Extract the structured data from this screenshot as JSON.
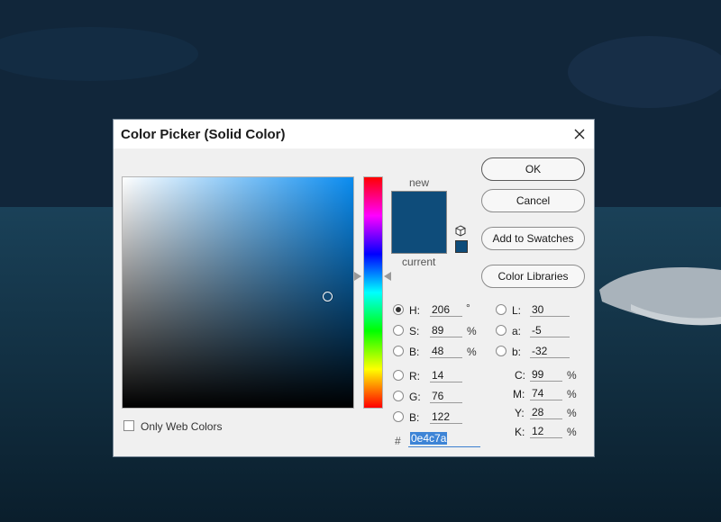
{
  "dialog": {
    "title": "Color Picker (Solid Color)",
    "close_icon": "close-icon"
  },
  "picker": {
    "new_label": "new",
    "current_label": "current",
    "new_color": "#0e4c7a",
    "current_color": "#0e4c7a",
    "field_hue_color": "#0a8cf0",
    "hue_fraction": 0.572,
    "saturation_fraction": 0.89,
    "brightness_fraction": 0.48
  },
  "buttons": {
    "ok": "OK",
    "cancel": "Cancel",
    "add_to_swatches": "Add to Swatches",
    "color_libraries": "Color Libraries"
  },
  "hsb": {
    "h_label": "H:",
    "h_value": "206",
    "h_unit": "°",
    "s_label": "S:",
    "s_value": "89",
    "s_unit": "%",
    "b_label": "B:",
    "b_value": "48",
    "b_unit": "%"
  },
  "rgb": {
    "r_label": "R:",
    "r_value": "14",
    "g_label": "G:",
    "g_value": "76",
    "b_label": "B:",
    "b_value": "122"
  },
  "lab": {
    "l_label": "L:",
    "l_value": "30",
    "a_label": "a:",
    "a_value": "-5",
    "b_label": "b:",
    "b_value": "-32"
  },
  "cmyk": {
    "c_label": "C:",
    "c_value": "99",
    "c_unit": "%",
    "m_label": "M:",
    "m_value": "74",
    "m_unit": "%",
    "y_label": "Y:",
    "y_value": "28",
    "y_unit": "%",
    "k_label": "K:",
    "k_value": "12",
    "k_unit": "%"
  },
  "hex": {
    "label": "#",
    "value": "0e4c7a"
  },
  "web_colors": {
    "label": "Only Web Colors",
    "checked": false
  }
}
